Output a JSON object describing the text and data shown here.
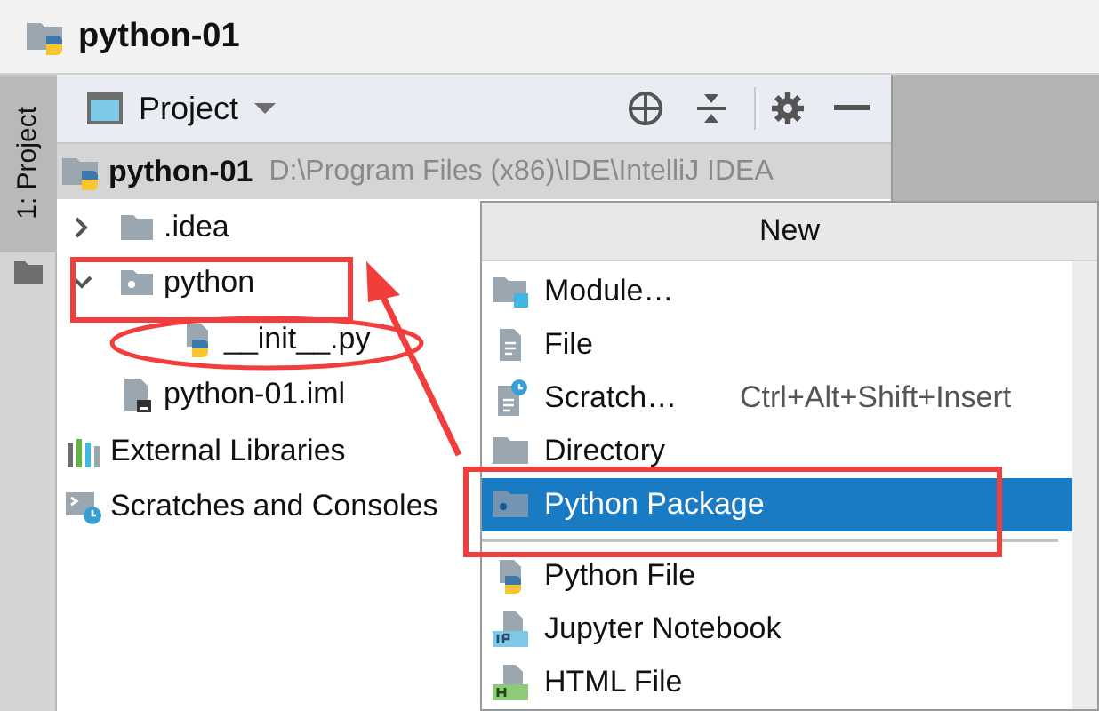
{
  "window": {
    "title": "python-01"
  },
  "side_tabs": [
    {
      "label": "1: Project",
      "selected": true
    }
  ],
  "panel": {
    "title": "Project"
  },
  "tree": {
    "root": {
      "name": "python-01",
      "path": "D:\\Program Files (x86)\\IDE\\IntelliJ IDEA",
      "selected": true,
      "children": [
        {
          "name": ".idea",
          "kind": "folder",
          "expanded": false
        },
        {
          "name": "python",
          "kind": "package",
          "expanded": true,
          "children": [
            {
              "name": "__init__.py",
              "kind": "python-file"
            }
          ]
        },
        {
          "name": "python-01.iml",
          "kind": "iml"
        }
      ]
    },
    "items": [
      {
        "name": "External Libraries",
        "kind": "libraries"
      },
      {
        "name": "Scratches and Consoles",
        "kind": "scratches"
      }
    ]
  },
  "menu": {
    "title": "New",
    "groups": [
      [
        {
          "label": "Module…",
          "kind": "module",
          "selected": false
        },
        {
          "label": "File",
          "kind": "file",
          "selected": false
        },
        {
          "label": "Scratch…",
          "kind": "scratch",
          "shortcut": "Ctrl+Alt+Shift+Insert",
          "selected": false
        },
        {
          "label": "Directory",
          "kind": "folder",
          "selected": false
        },
        {
          "label": "Python Package",
          "kind": "package",
          "selected": true
        }
      ],
      [
        {
          "label": "Python File",
          "kind": "python-file",
          "selected": false
        },
        {
          "label": "Jupyter Notebook",
          "kind": "jupyter",
          "selected": false
        },
        {
          "label": "HTML File",
          "kind": "html",
          "selected": false
        }
      ]
    ]
  }
}
